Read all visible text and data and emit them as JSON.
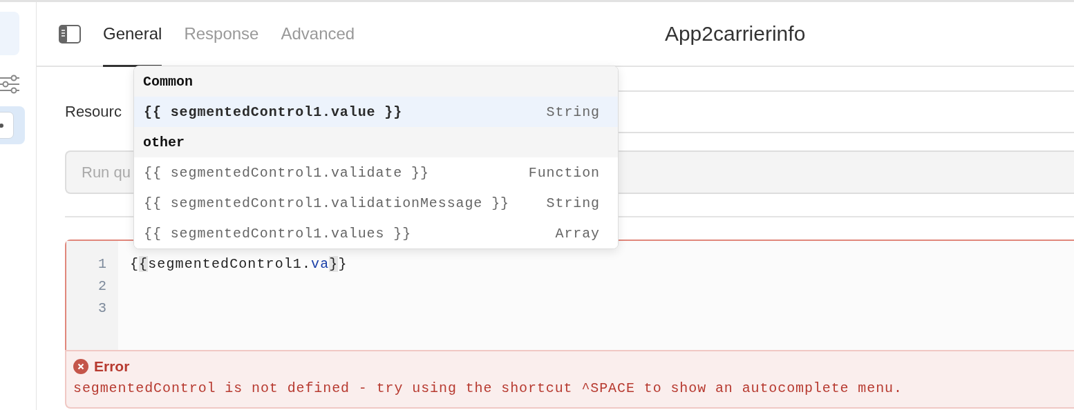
{
  "header": {
    "tabs": [
      {
        "label": "General",
        "selected": true
      },
      {
        "label": "Response",
        "selected": false
      },
      {
        "label": "Advanced",
        "selected": false
      }
    ],
    "title": "App2carrierinfo"
  },
  "form": {
    "resource_label": "Resourc",
    "query_field": {
      "placeholder": "Run qu"
    }
  },
  "editor": {
    "line_numbers": [
      "1",
      "2",
      "3"
    ],
    "code": [
      {
        "text": "{",
        "kind": "plain"
      },
      {
        "text": "{",
        "kind": "matched-brace"
      },
      {
        "text": "segmentedControl1.",
        "kind": "plain"
      },
      {
        "text": "va",
        "kind": "property"
      },
      {
        "text": "}",
        "kind": "matched-brace"
      },
      {
        "text": "}",
        "kind": "plain"
      }
    ]
  },
  "error": {
    "title": "Error",
    "message": "segmentedControl is not defined - try using the shortcut ^SPACE to show an autocomplete menu."
  },
  "autocomplete": {
    "groups": [
      {
        "heading": "Common",
        "items": [
          {
            "label": "{{ segmentedControl1.value }}",
            "type": "String",
            "selected": true
          }
        ]
      },
      {
        "heading": "other",
        "items": [
          {
            "label": "{{ segmentedControl1.validate }}",
            "type": "Function",
            "selected": false
          },
          {
            "label": "{{ segmentedControl1.validationMessage }}",
            "type": "String",
            "selected": false
          },
          {
            "label": "{{ segmentedControl1.values }}",
            "type": "Array",
            "selected": false
          }
        ]
      }
    ]
  }
}
